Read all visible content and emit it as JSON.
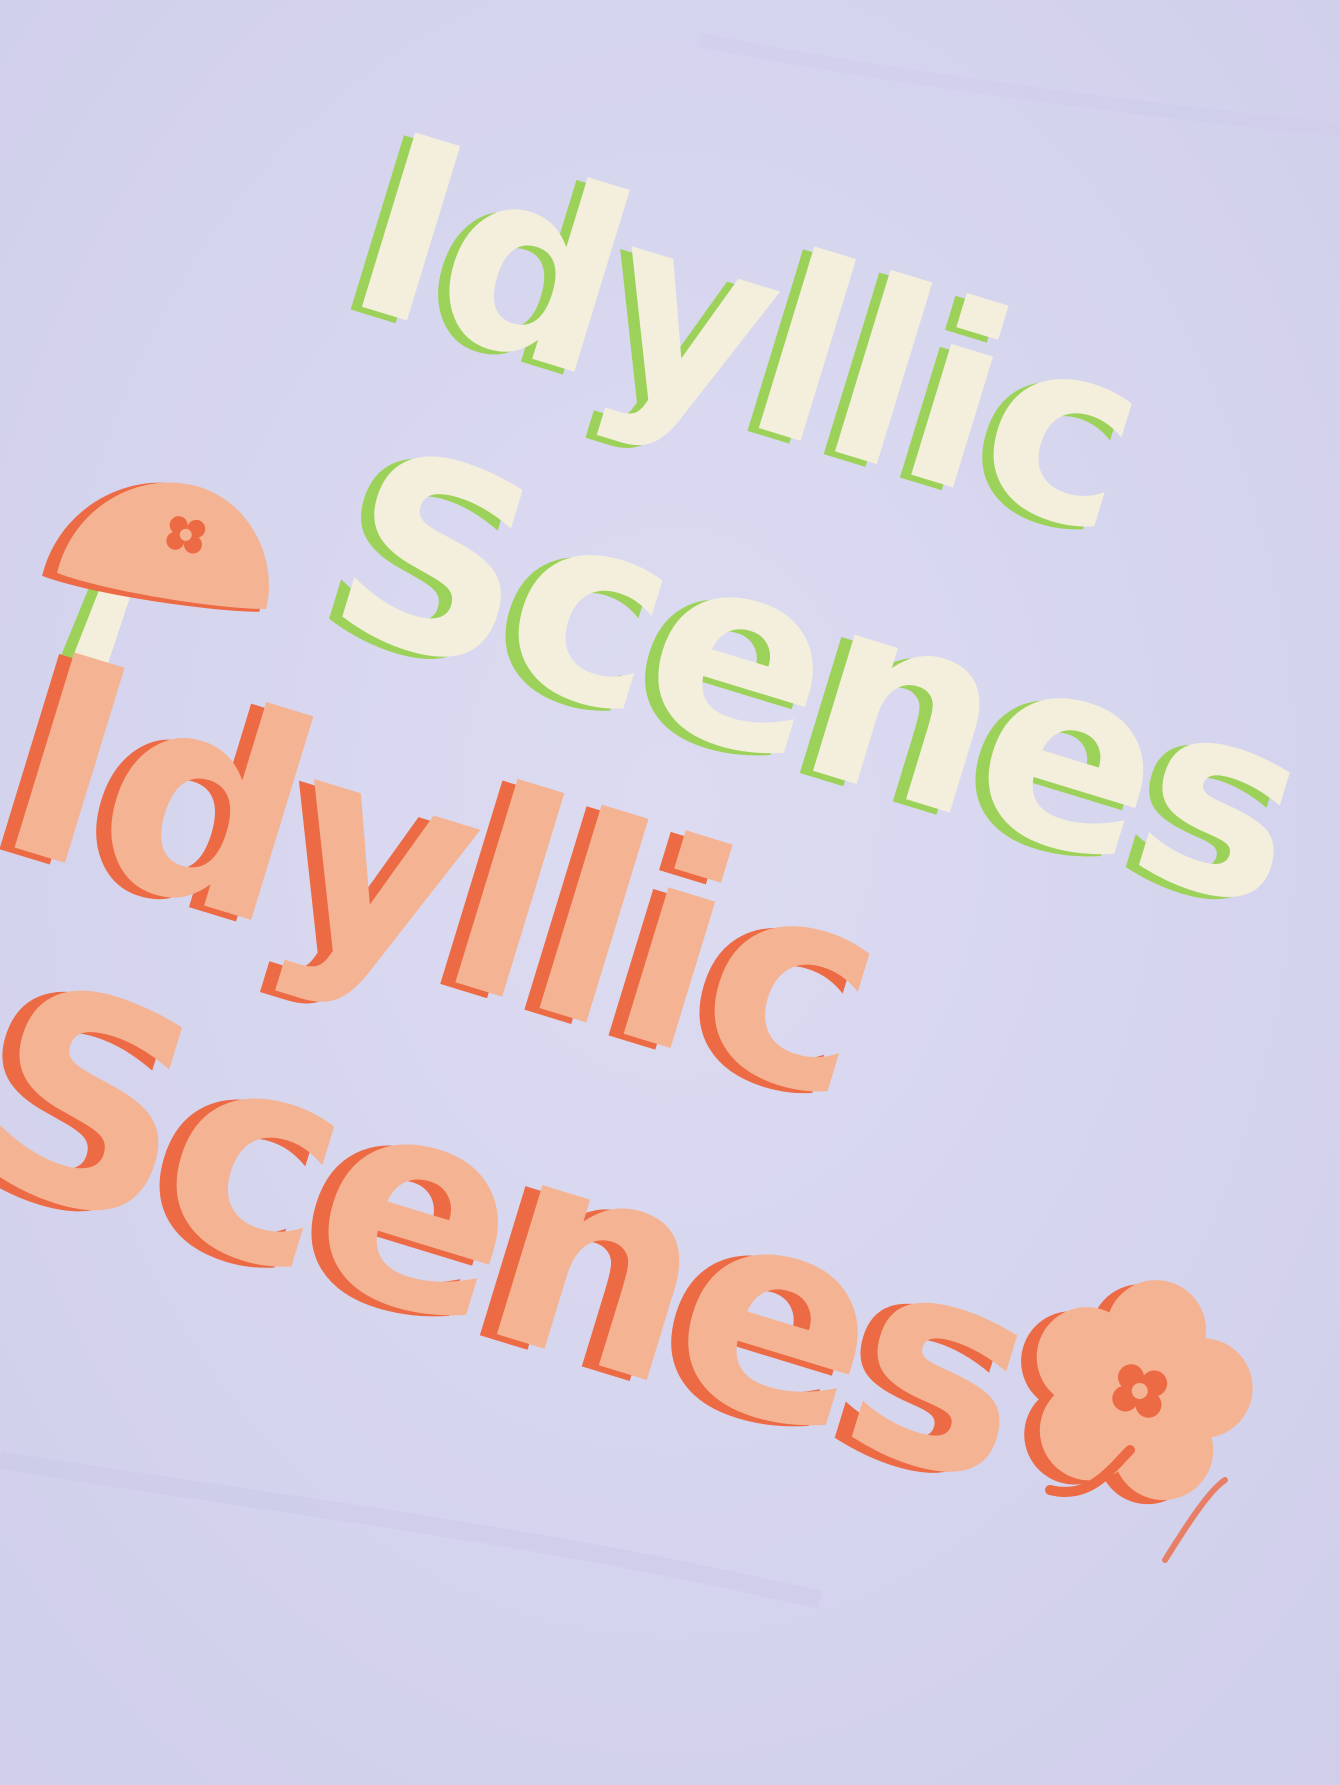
{
  "fabric": {
    "color": "#d8d7f0"
  },
  "print_top": {
    "line1": "Idyllic",
    "line2": "Scenes",
    "fill_color": "#f3efdc",
    "shadow_color": "#9dd25a"
  },
  "print_bottom": {
    "line1": "Idyllic",
    "line2": "Scenes",
    "fill_color": "#f4b494",
    "shadow_color": "#ec6a44"
  },
  "graphics": {
    "mushroom": {
      "icon": "mushroom-icon",
      "cap_color": "#f4b494",
      "cap_shadow": "#ec6a44",
      "stem_color": "#f3efdc",
      "stem_shadow": "#9dd25a"
    },
    "flower": {
      "icon": "flower-icon",
      "petal_color": "#f4b494",
      "petal_shadow": "#ec6a44"
    }
  }
}
